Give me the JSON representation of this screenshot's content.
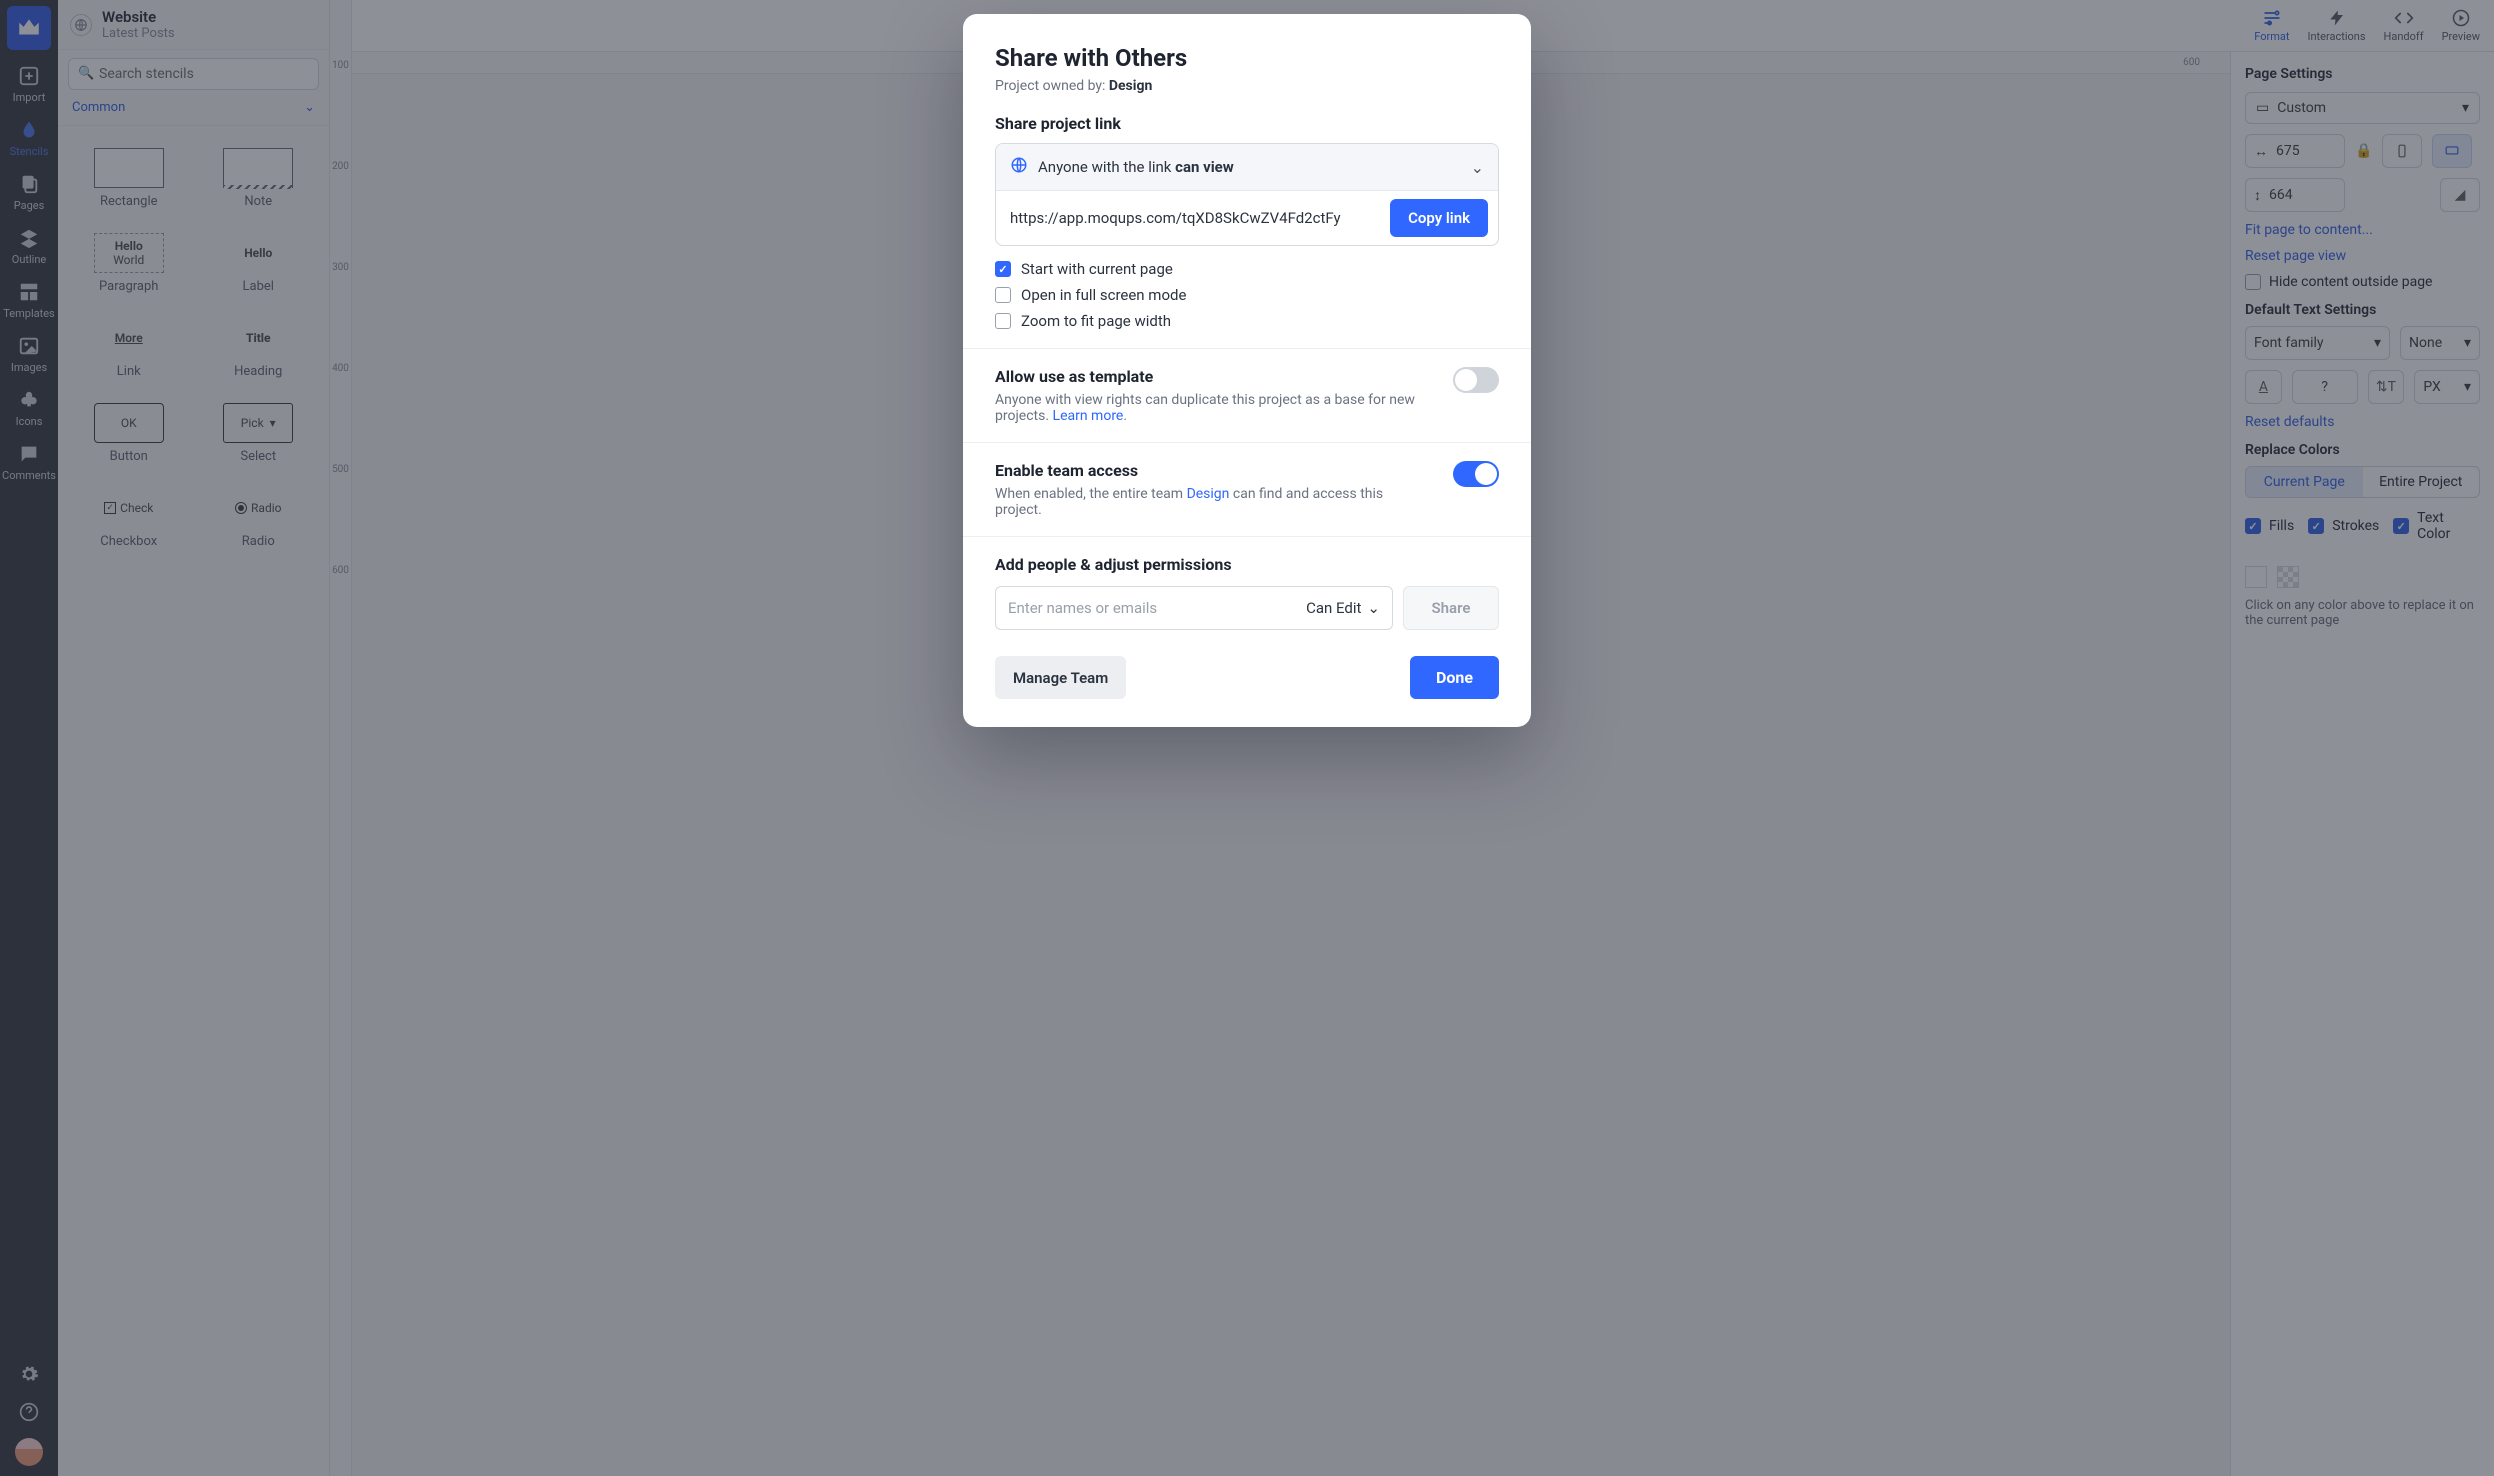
{
  "project": {
    "title": "Website",
    "subtitle": "Latest Posts"
  },
  "rail": {
    "import": "Import",
    "stencils": "Stencils",
    "pages": "Pages",
    "outline": "Outline",
    "templates": "Templates",
    "images": "Images",
    "icons": "Icons",
    "comments": "Comments"
  },
  "search_placeholder": "Search stencils",
  "category": "Common",
  "stencils": {
    "rectangle": "Rectangle",
    "note": "Note",
    "paragraph": "Paragraph",
    "label": "Label",
    "para_line1": "Hello",
    "para_line2": "World",
    "label_text": "Hello",
    "link": "Link",
    "heading": "Heading",
    "link_text": "More",
    "heading_text": "Title",
    "button": "Button",
    "select": "Select",
    "button_text": "OK",
    "select_text": "Pick",
    "checkbox": "Checkbox",
    "radio": "Radio",
    "check_text": "Check",
    "radio_text": "Radio"
  },
  "ruler_v": [
    "100",
    "200",
    "300",
    "400",
    "500",
    "600"
  ],
  "ruler_h_mark": "600",
  "topbar": {
    "format": "Format",
    "interactions": "Interactions",
    "handoff": "Handoff",
    "preview": "Preview"
  },
  "right": {
    "page_settings": "Page Settings",
    "custom": "Custom",
    "w": "675",
    "h": "664",
    "fit": "Fit page to content...",
    "reset_view": "Reset page view",
    "hide": "Hide content outside page",
    "text_settings": "Default Text Settings",
    "font_family": "Font family",
    "none": "None",
    "size_q": "?",
    "px": "PX",
    "reset_defaults": "Reset defaults",
    "replace": "Replace Colors",
    "seg_current": "Current Page",
    "seg_project": "Entire Project",
    "fills": "Fills",
    "strokes": "Strokes",
    "textcolor": "Text Color",
    "replace_note": "Click on any color above to replace it on the current page"
  },
  "modal": {
    "title": "Share with Others",
    "owned_by_pre": "Project owned by: ",
    "owned_by": "Design",
    "share_link": "Share project link",
    "perm_pre": "Anyone with the link ",
    "perm_bold": "can view",
    "url": "https://app.moqups.com/tqXD8SkCwZV4Fd2ctFy",
    "copy": "Copy link",
    "start_current": "Start with current page",
    "fullscreen": "Open in full screen mode",
    "zoom_fit": "Zoom to fit page width",
    "template_title": "Allow use as template",
    "template_desc_a": "Anyone with view rights can duplicate this project as a base for new projects. ",
    "template_desc_link": "Learn more",
    "team_title": "Enable team access",
    "team_desc_a": "When enabled, the entire team ",
    "team_link": "Design",
    "team_desc_b": " can find and access this project.",
    "people_title": "Add people & adjust permissions",
    "people_placeholder": "Enter names or emails",
    "people_perm": "Can Edit",
    "share": "Share",
    "manage": "Manage Team",
    "done": "Done",
    "start_current_checked": true,
    "fullscreen_checked": false,
    "zoom_checked": false,
    "template_on": false,
    "team_on": true
  }
}
